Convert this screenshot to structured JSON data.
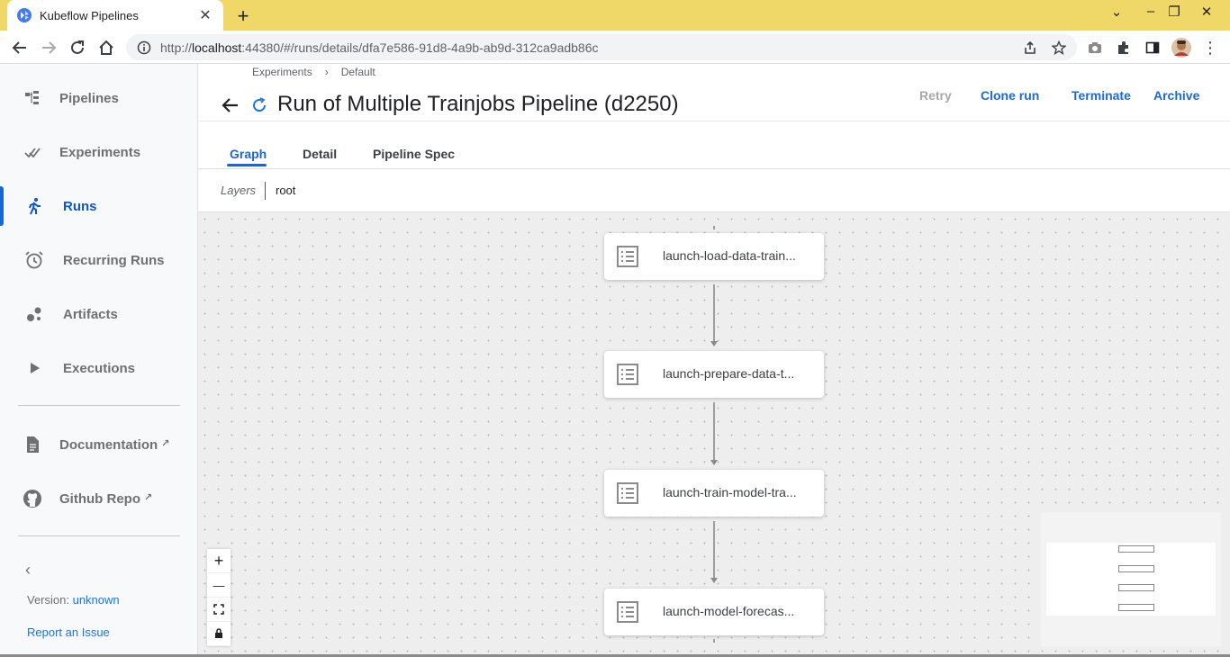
{
  "browser": {
    "tab_title": "Kubeflow Pipelines",
    "new_tab": "+",
    "url_host": "localhost",
    "url_rest": ":44380/#/runs/details/dfa7e586-91d8-4a9b-ab9d-312ca9adb86c",
    "url_scheme": "http://",
    "icons": [
      "back-icon",
      "forward-icon",
      "reload-icon",
      "home-icon",
      "info-icon",
      "share-icon",
      "star-icon",
      "camera-icon",
      "extensions-icon",
      "side-panel-icon",
      "avatar",
      "menu-icon"
    ]
  },
  "sidebar": {
    "items": [
      {
        "label": "Pipelines",
        "icon": "pipelines-icon"
      },
      {
        "label": "Experiments",
        "icon": "experiments-icon"
      },
      {
        "label": "Runs",
        "icon": "runs-icon",
        "active": true
      },
      {
        "label": "Recurring Runs",
        "icon": "alarm-icon"
      },
      {
        "label": "Artifacts",
        "icon": "artifacts-icon"
      },
      {
        "label": "Executions",
        "icon": "play-icon"
      }
    ],
    "links": [
      {
        "label": "Documentation",
        "icon": "document-icon"
      },
      {
        "label": "Github Repo",
        "icon": "github-icon"
      }
    ],
    "version_prefix": "Version: ",
    "version_value": "unknown",
    "report_issue": "Report an Issue",
    "accent": "#1967d2"
  },
  "header": {
    "breadcrumb": [
      "Experiments",
      "›",
      "Default"
    ],
    "title": "Run of Multiple Trainjobs Pipeline (d2250)",
    "actions": {
      "retry": "Retry",
      "clone": "Clone run",
      "terminate": "Terminate",
      "archive": "Archive"
    }
  },
  "tabs": [
    "Graph",
    "Detail",
    "Pipeline Spec"
  ],
  "layers": {
    "label": "Layers",
    "value": "root"
  },
  "graph": {
    "nodes": [
      "launch-load-data-train...",
      "launch-prepare-data-t...",
      "launch-train-model-tra...",
      "launch-model-forecas..."
    ],
    "zoom_controls": [
      "+",
      "—"
    ]
  }
}
